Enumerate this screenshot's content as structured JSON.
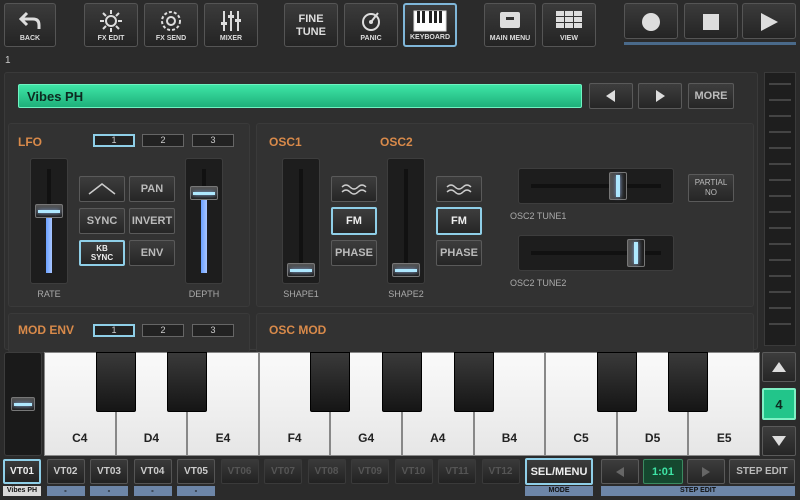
{
  "toolbar": {
    "back": "BACK",
    "fx_edit": "FX EDIT",
    "fx_send": "FX SEND",
    "mixer": "MIXER",
    "fine_tune_line1": "FINE",
    "fine_tune_line2": "TUNE",
    "panic": "PANIC",
    "keyboard": "KEYBOARD",
    "main_menu": "MAIN MENU",
    "view": "VIEW"
  },
  "slot": {
    "number": "1"
  },
  "preset": {
    "name": "Vibes PH",
    "more": "MORE"
  },
  "lfo": {
    "title": "LFO",
    "tabs": [
      "1",
      "2",
      "3"
    ],
    "sync": "SYNC",
    "kb_sync_1": "KB",
    "kb_sync_2": "SYNC",
    "pan": "PAN",
    "invert": "INVERT",
    "env": "ENV",
    "rate": "RATE",
    "depth": "DEPTH",
    "rate_value": 0.62,
    "depth_value": 0.82
  },
  "mod_env": {
    "title": "MOD ENV",
    "tabs": [
      "1",
      "2",
      "3"
    ]
  },
  "osc": {
    "osc1_title": "OSC1",
    "osc2_title": "OSC2",
    "fm": "FM",
    "phase": "PHASE",
    "shape1": "SHAPE1",
    "shape2": "SHAPE2",
    "tune1": "OSC2 TUNE1",
    "tune2": "OSC2 TUNE2",
    "partial_1": "PARTIAL",
    "partial_2": "NO",
    "tune1_value": 0.68,
    "tune2_value": 0.84
  },
  "osc_mod": {
    "title": "OSC MOD"
  },
  "keyboard": {
    "white_keys": [
      "C4",
      "D4",
      "E4",
      "F4",
      "G4",
      "A4",
      "B4",
      "C5",
      "D5",
      "E5"
    ],
    "octave": "4"
  },
  "tracks": {
    "items": [
      "VT01",
      "VT02",
      "VT03",
      "VT04",
      "VT05",
      "VT06",
      "VT07",
      "VT08",
      "VT09",
      "VT10",
      "VT11",
      "VT12"
    ],
    "selected_sub": "Vibes PH",
    "sub": "-",
    "sel_menu": "SEL/MENU",
    "mode": "MODE",
    "position": "1:01",
    "step_edit": "STEP EDIT",
    "step_edit_lbl": "STEP EDIT"
  },
  "colors": {
    "accent": "#3ee5a6",
    "highlight": "#8fcfe8",
    "section_title": "#d98a4a"
  }
}
